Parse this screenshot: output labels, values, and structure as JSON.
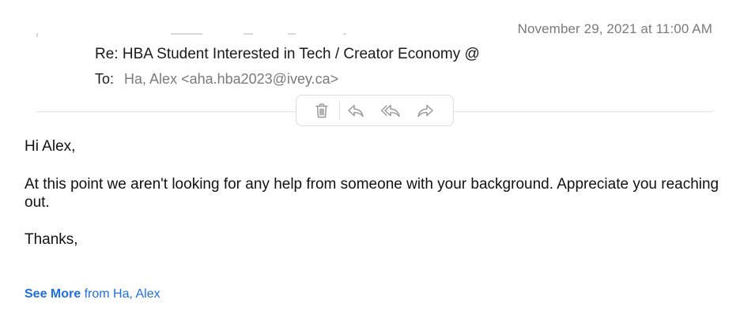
{
  "header": {
    "date": "November 29, 2021 at 11:00 AM",
    "subject": "Re: HBA Student Interested in Tech / Creator Economy @",
    "to_label": "To:",
    "to_value": "Ha, Alex <aha.hba2023@ivey.ca>"
  },
  "toolbar": {
    "icons": [
      "trash-icon",
      "reply-icon",
      "reply-all-icon",
      "forward-icon"
    ]
  },
  "body": {
    "greeting": "Hi Alex,",
    "paragraph": "At this point we aren't looking for any help from someone with your background. Appreciate you reaching out.",
    "closing": "Thanks,"
  },
  "footer": {
    "see_more": "See More",
    "from_text": " from Ha, Alex"
  },
  "colors": {
    "link": "#1f6fe0",
    "muted_text": "#7a7a7a",
    "icon_stroke": "#9a9a9a"
  }
}
